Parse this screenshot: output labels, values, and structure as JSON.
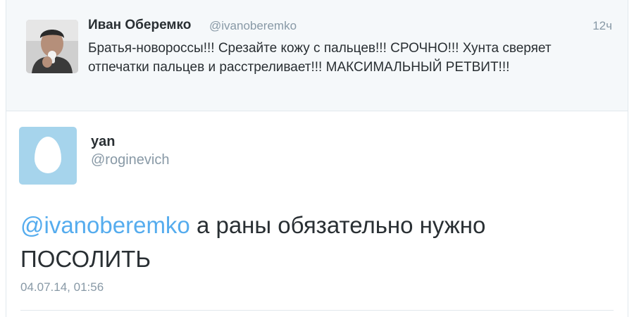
{
  "parent_tweet": {
    "author_name": "Иван Оберемко",
    "author_handle": "@ivanoberemko",
    "time": "12ч",
    "text": "Братья-новороссы!!! Срезайте кожу с пальцев!!! СРОЧНО!!! Хунта сверяет отпечатки пальцев и расстреливает!!! МАКСИМАЛЬНЫЙ РЕТВИТ!!!"
  },
  "main_tweet": {
    "author_name": "yan",
    "author_handle": "@roginevich",
    "mention": "@ivanoberemko",
    "text": " а раны обязательно нужно ПОСОЛИТЬ",
    "date": "04.07.14, 01:56"
  },
  "colors": {
    "link": "#55acee",
    "muted": "#8899a6",
    "text": "#292f33",
    "egg_bg": "#a6d4ec"
  }
}
